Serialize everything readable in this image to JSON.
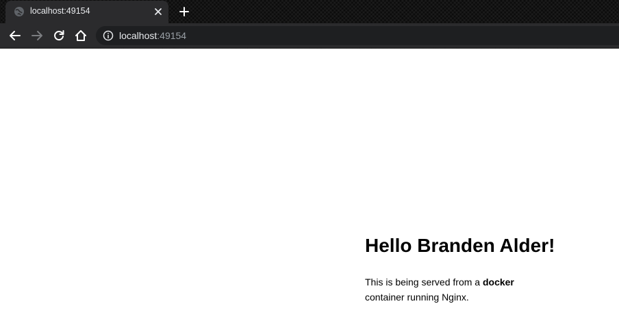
{
  "browser": {
    "tab": {
      "title": "localhost:49154",
      "favicon": "globe-icon",
      "close_icon": "close-icon"
    },
    "new_tab_icon": "plus-icon",
    "toolbar": {
      "back_icon": "arrow-left-icon",
      "forward_icon": "arrow-right-icon",
      "reload_icon": "reload-icon",
      "home_icon": "home-icon",
      "info_icon": "info-icon"
    },
    "address_bar": {
      "host": "localhost",
      "port": ":49154"
    },
    "colors": {
      "chrome_background": "#0b0b0b",
      "toolbar_background": "#2b2b2d",
      "omnibox_background": "#1e1f21",
      "text_primary": "#e8eaed",
      "text_secondary": "#9aa0a6"
    }
  },
  "page": {
    "heading": "Hello Branden Alder!",
    "paragraph_prefix": "This is being served from a ",
    "paragraph_bold": "docker",
    "paragraph_suffix": " container running Nginx."
  }
}
